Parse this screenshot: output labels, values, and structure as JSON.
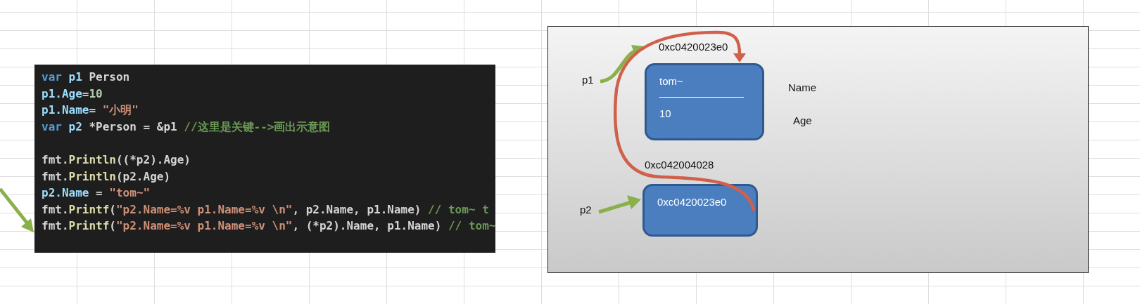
{
  "code": {
    "lines": [
      {
        "segments": [
          {
            "kind": "keyword",
            "text": "var "
          },
          {
            "kind": "ident",
            "text": "p1"
          },
          {
            "kind": "plain",
            "text": " Person"
          }
        ]
      },
      {
        "segments": [
          {
            "kind": "ident",
            "text": "p1.Age"
          },
          {
            "kind": "plain",
            "text": "="
          },
          {
            "kind": "number",
            "text": "10"
          }
        ]
      },
      {
        "segments": [
          {
            "kind": "ident",
            "text": "p1.Name"
          },
          {
            "kind": "plain",
            "text": "= "
          },
          {
            "kind": "string",
            "text": "\"小明\""
          }
        ]
      },
      {
        "segments": [
          {
            "kind": "keyword",
            "text": "var "
          },
          {
            "kind": "ident",
            "text": "p2"
          },
          {
            "kind": "plain",
            "text": " *Person = &p1 "
          },
          {
            "kind": "comment",
            "text": "//这里是关键-->画出示意图"
          }
        ]
      },
      {
        "gap_before": true,
        "segments": [
          {
            "kind": "plain",
            "text": "fmt."
          },
          {
            "kind": "func",
            "text": "Println"
          },
          {
            "kind": "plain",
            "text": "((*p2).Age)"
          }
        ]
      },
      {
        "segments": [
          {
            "kind": "plain",
            "text": "fmt."
          },
          {
            "kind": "func",
            "text": "Println"
          },
          {
            "kind": "plain",
            "text": "(p2.Age)"
          }
        ]
      },
      {
        "segments": [
          {
            "kind": "ident",
            "text": "p2.Name"
          },
          {
            "kind": "plain",
            "text": " = "
          },
          {
            "kind": "string",
            "text": "\"tom~\""
          }
        ]
      },
      {
        "segments": [
          {
            "kind": "plain",
            "text": "fmt."
          },
          {
            "kind": "func",
            "text": "Printf"
          },
          {
            "kind": "plain",
            "text": "("
          },
          {
            "kind": "string",
            "text": "\"p2.Name=%v p1.Name=%v \\n\""
          },
          {
            "kind": "plain",
            "text": ", p2.Name, p1.Name) "
          },
          {
            "kind": "comment",
            "text": "// tom~ t"
          }
        ]
      },
      {
        "segments": [
          {
            "kind": "plain",
            "text": "fmt."
          },
          {
            "kind": "func",
            "text": "Printf"
          },
          {
            "kind": "plain",
            "text": "("
          },
          {
            "kind": "string",
            "text": "\"p2.Name=%v p1.Name=%v \\n\""
          },
          {
            "kind": "plain",
            "text": ", (*p2).Name, p1.Name) "
          },
          {
            "kind": "comment",
            "text": "// tom~"
          }
        ]
      }
    ]
  },
  "diagram": {
    "pointers": [
      {
        "label": "p1"
      },
      {
        "label": "p2"
      }
    ],
    "boxes": [
      {
        "address": "0xc0420023e0",
        "fields": [
          "tom~",
          "10"
        ]
      },
      {
        "address": "0xc042004028",
        "fields": [
          "0xc0420023e0"
        ]
      }
    ],
    "field_names": [
      "Name",
      "Age"
    ]
  }
}
